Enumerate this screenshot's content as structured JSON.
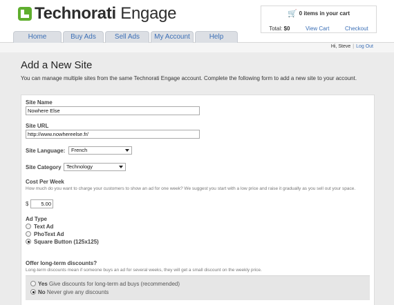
{
  "brand": {
    "name_bold": "Technorati",
    "name_rest": " Engage"
  },
  "cart": {
    "items_text": "0 items in your cart",
    "total_label": "Total:",
    "total_value": "$0",
    "view_cart": "View Cart",
    "checkout": "Checkout"
  },
  "nav": {
    "tabs": [
      {
        "label": "Home"
      },
      {
        "label": "Buy Ads"
      },
      {
        "label": "Sell Ads"
      },
      {
        "label": "My Account"
      },
      {
        "label": "Help"
      }
    ]
  },
  "user": {
    "greeting": "Hi, Steve",
    "logout": "Log Out",
    "separator": "|"
  },
  "page": {
    "title": "Add a New Site",
    "intro": "You can manage multiple sites from the same Technorati Engage account. Complete the following form to add a new site to your account."
  },
  "form": {
    "site_name": {
      "label": "Site Name",
      "value": "Nowhere Else"
    },
    "site_url": {
      "label": "Site URL",
      "value": "http://www.nowhereelse.fr/"
    },
    "site_language": {
      "label": "Site Language:",
      "value": "French"
    },
    "site_category": {
      "label": "Site Category",
      "value": "Technology"
    },
    "cost": {
      "label": "Cost Per Week",
      "help": "How much do you want to charge your customers to show an ad for one week? We suggest you start with a low price and raise it gradually as you sell out your space.",
      "currency": "$",
      "value": "5.00"
    },
    "ad_type": {
      "label": "Ad Type",
      "options": [
        {
          "label": "Text Ad",
          "selected": false
        },
        {
          "label": "PhoText Ad",
          "selected": false
        },
        {
          "label": "Square Button (125x125)",
          "selected": true
        }
      ]
    },
    "discounts": {
      "label": "Offer long-term discounts?",
      "help": "Long-term discounts mean if someone buys an ad for several weeks, they will get a small discount on the weekly price.",
      "options": [
        {
          "label": "Yes",
          "desc": "Give discounts for long-term ad buys (recommended)",
          "selected": false
        },
        {
          "label": "No",
          "desc": "Never give any discounts",
          "selected": true
        }
      ]
    }
  },
  "colors": {
    "brand_green": "#5fae2e",
    "link_blue": "#3b6fb6",
    "tab_bg": "#dcdfe4"
  },
  "icons": {
    "cart": "cart-icon",
    "logo": "technorati-logo-icon"
  }
}
